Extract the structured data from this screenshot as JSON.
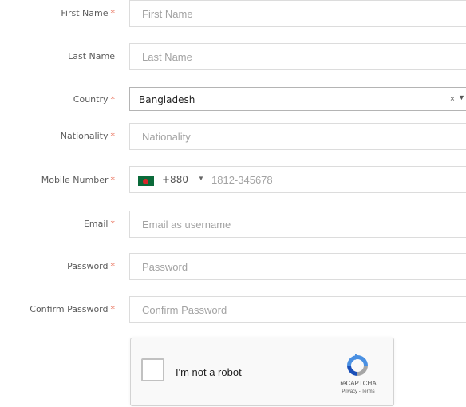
{
  "form": {
    "first_name": {
      "label": "First Name",
      "required": "*",
      "placeholder": "First Name"
    },
    "last_name": {
      "label": "Last Name",
      "placeholder": "Last Name"
    },
    "country": {
      "label": "Country",
      "required": "*",
      "value": "Bangladesh",
      "clear": "×",
      "arrow": "▼"
    },
    "nationality": {
      "label": "Nationality",
      "required": "*",
      "placeholder": "Nationality"
    },
    "mobile": {
      "label": "Mobile Number",
      "required": "*",
      "flag_icon": "bangladesh-flag-icon",
      "dial_code": "+880",
      "caret": "▼",
      "placeholder": "1812-345678"
    },
    "email": {
      "label": "Email",
      "required": "*",
      "placeholder": "Email as username"
    },
    "password": {
      "label": "Password",
      "required": "*",
      "placeholder": "Password"
    },
    "confirm_password": {
      "label": "Confirm Password",
      "required": "*",
      "placeholder": "Confirm Password"
    }
  },
  "recaptcha": {
    "label": "I'm not a robot",
    "brand": "reCAPTCHA",
    "links": "Privacy - Terms",
    "logo_icon": "recaptcha-logo-icon"
  },
  "colors": {
    "required_star": "#e8674f",
    "label_text": "#5b5b5b",
    "placeholder_text": "#a3a3a3",
    "border": "#dcdcdc",
    "flag_green": "#0b6a3a",
    "flag_red": "#d9252a"
  }
}
